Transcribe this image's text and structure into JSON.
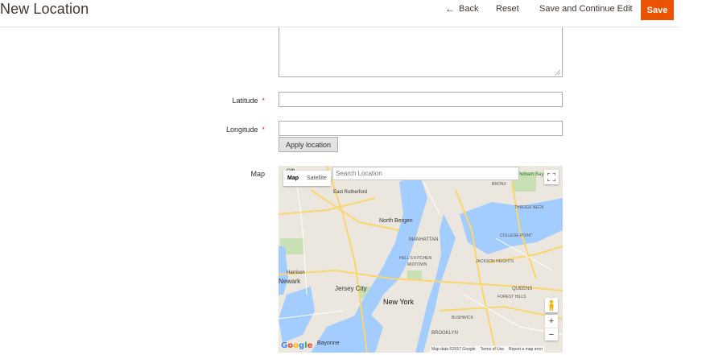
{
  "header": {
    "title": "New Location",
    "back_label": "Back",
    "reset_label": "Reset",
    "save_continue_label": "Save and Continue Edit",
    "save_label": "Save",
    "accent_color": "#eb5202"
  },
  "form": {
    "latitude_label": "Latitude",
    "longitude_label": "Longitude",
    "required_mark": "*",
    "latitude_value": "",
    "longitude_value": "",
    "apply_label": "Apply location",
    "map_label": "Map"
  },
  "map": {
    "type_map_label": "Map",
    "type_satellite_label": "Satellite",
    "search_placeholder": "Search Location",
    "google_logo": "Google",
    "attribution": "Map data ©2017 Google",
    "terms_label": "Terms of Use",
    "report_label": "Report a map error",
    "zoom_in_label": "+",
    "zoom_out_label": "−",
    "place_labels": {
      "new_york": "New York",
      "jersey_city": "Jersey City",
      "newark": "Newark",
      "north_bergen": "North Bergen",
      "manhattan": "MANHATTAN",
      "harrison": "Harrison",
      "east_rutherford": "East Rutherford",
      "bayonne": "Bayonne",
      "brooklyn": "BROOKLYN",
      "queens": "QUEENS",
      "jackson_heights": "JACKSON HEIGHTS",
      "college_point": "COLLEGE POINT",
      "forest_hills": "FOREST HILLS",
      "bushwick": "BUSHWICK",
      "midtown": "MIDTOWN",
      "hells_kitchen": "HELL'S KITCHEN",
      "bronx": "BRONX",
      "throgs_neck": "THROGS NECK",
      "pelham_bay_park": "Pelham Bay Park",
      "cliffside": "Clift"
    }
  }
}
